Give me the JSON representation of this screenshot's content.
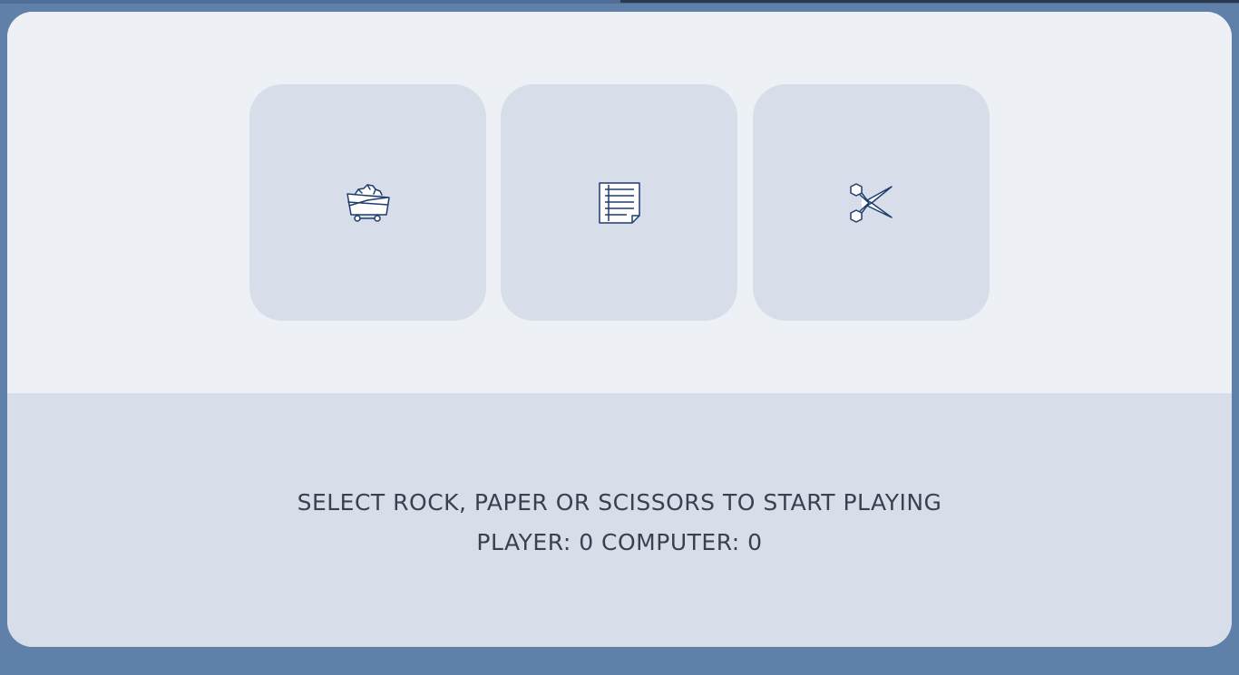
{
  "choices": [
    {
      "id": "rock",
      "icon": "mine-cart-rock-icon"
    },
    {
      "id": "paper",
      "icon": "lined-paper-icon"
    },
    {
      "id": "scissors",
      "icon": "scissors-icon"
    }
  ],
  "status": {
    "message": "SELECT ROCK, PAPER OR SCISSORS TO START PLAYING",
    "score_line": "PLAYER: 0 COMPUTER: 0",
    "player_label": "PLAYER:",
    "player_score": 0,
    "computer_label": "COMPUTER:",
    "computer_score": 0
  },
  "colors": {
    "background": "#5f80a9",
    "panel_top": "#edf1f6",
    "panel_bottom": "#d8dee9",
    "card": "#d8dee9",
    "icon_stroke": "#1f3d6e",
    "text": "#394150"
  }
}
